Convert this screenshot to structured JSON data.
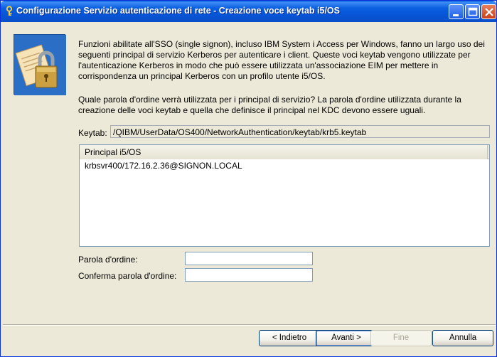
{
  "window": {
    "title": "Configurazione Servizio autenticazione di rete - Creazione voce keytab i5/OS",
    "controls": [
      "minimize-icon",
      "maximize-icon",
      "close-icon"
    ]
  },
  "hero_icon": "padlock-certificate-icon",
  "intro": {
    "paragraph1": "Funzioni abilitate all'SSO (single signon), incluso IBM System i Access per Windows, fanno un largo uso dei seguenti principal di servizio Kerberos per autenticare i client. Queste voci keytab vengono utilizzate per l'autenticazione Kerberos in modo che può essere utilizzata un'associazione EIM per mettere in corrispondenza un principal Kerberos con un profilo utente i5/OS.",
    "paragraph2": "Quale parola d'ordine verrà utilizzata per i principal di servizio?  La parola d'ordine utilizzata durante la creazione delle voci keytab e quella che definisce il principal nel KDC devono essere uguali."
  },
  "keytab": {
    "label": "Keytab:",
    "value": "/QIBM/UserData/OS400/NetworkAuthentication/keytab/krb5.keytab"
  },
  "principal_table": {
    "column_header": "Principal i5/OS",
    "rows": [
      "krbsvr400/172.16.2.36@SIGNON.LOCAL"
    ]
  },
  "form": {
    "password_label": "Parola d'ordine:",
    "password_value": "",
    "confirm_label": "Conferma parola d'ordine:",
    "confirm_value": ""
  },
  "buttons": {
    "back": "< Indietro",
    "next": "Avanti >",
    "finish": "Fine",
    "cancel": "Annulla"
  },
  "colors": {
    "titlebar": "#0a5fe0",
    "dialog_background": "#ece9d8",
    "input_border": "#7f9db9"
  }
}
